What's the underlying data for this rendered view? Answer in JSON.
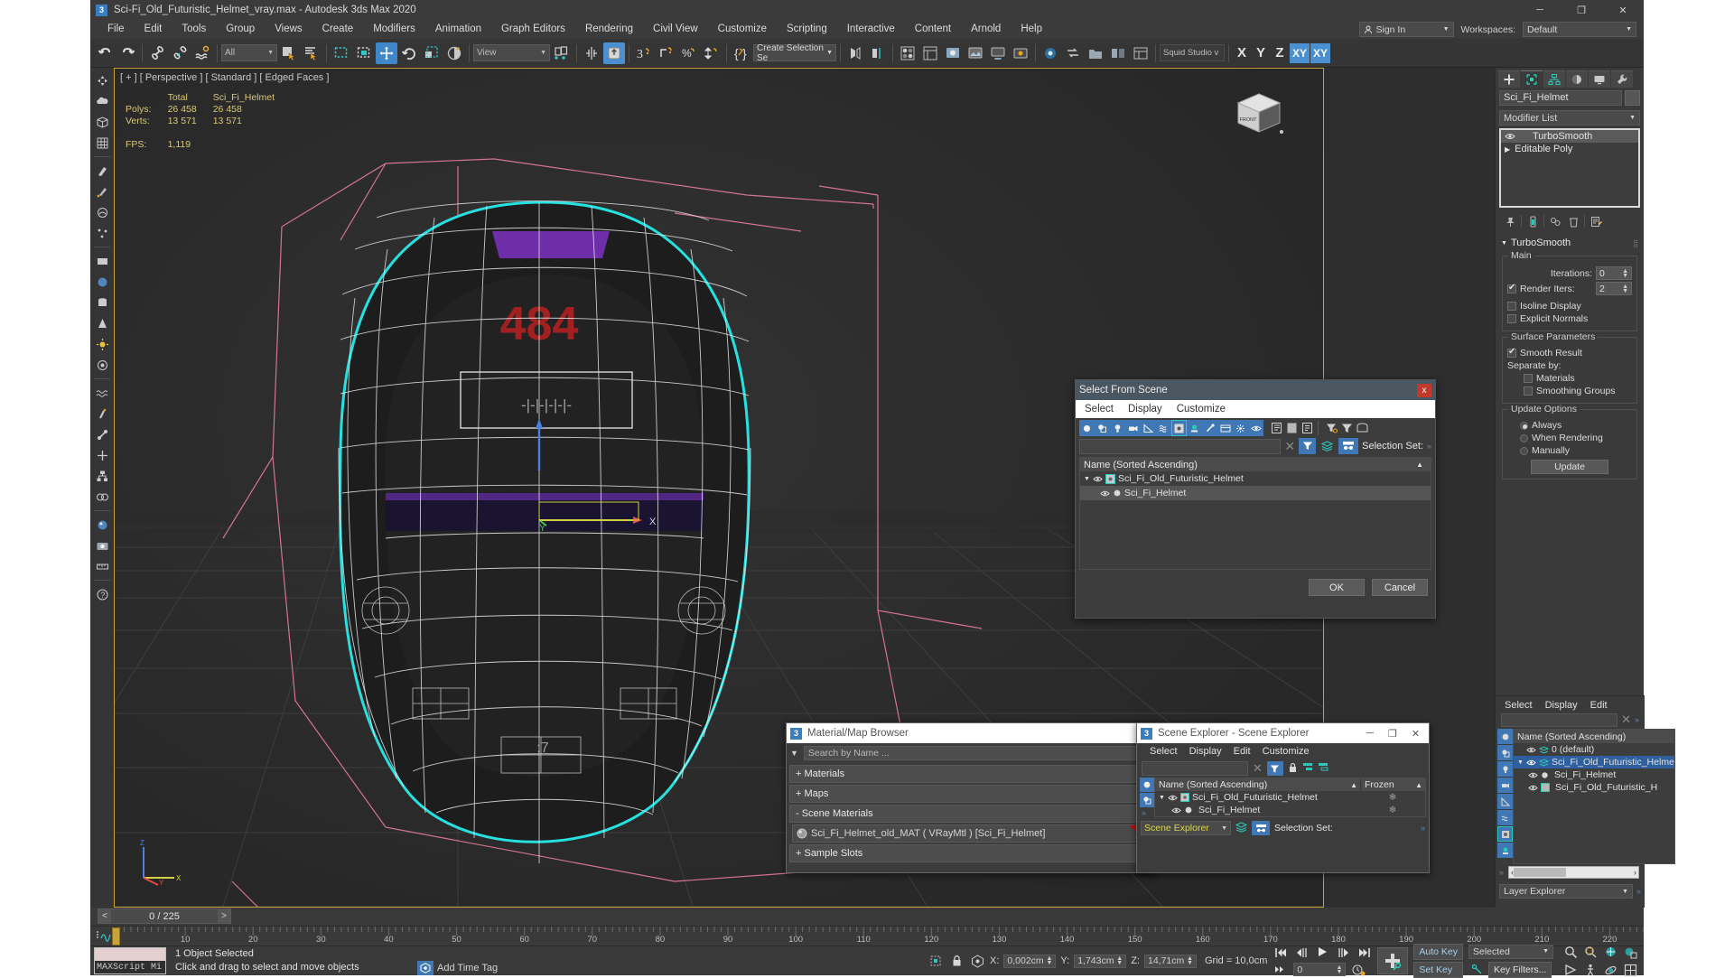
{
  "window": {
    "title": "Sci-Fi_Old_Futuristic_Helmet_vray.max - Autodesk 3ds Max 2020",
    "app_icon": "3",
    "minimize": "─",
    "maximize": "❐",
    "close": "✕"
  },
  "menubar": {
    "items": [
      "File",
      "Edit",
      "Tools",
      "Group",
      "Views",
      "Create",
      "Modifiers",
      "Animation",
      "Graph Editors",
      "Rendering",
      "Civil View",
      "Customize",
      "Scripting",
      "Interactive",
      "Content",
      "Arnold",
      "Help"
    ],
    "sign_in": "Sign In",
    "workspaces_label": "Workspaces:",
    "workspace_value": "Default"
  },
  "toolbar": {
    "selection_filter": "All",
    "reference_coord": "View",
    "named_selection_set": "Create Selection Se",
    "render_preset": "Squid Studio v",
    "axis_constraints": [
      "X",
      "Y",
      "Z",
      "XY",
      "XY"
    ],
    "active_axis": "XY"
  },
  "viewport": {
    "label": "[ + ] [ Perspective ] [ Standard ] [ Edged Faces ]",
    "stats": {
      "col_total": "Total",
      "col_object": "Sci_Fi_Helmet",
      "polys_label": "Polys:",
      "polys_total": "26 458",
      "polys_object": "26 458",
      "verts_label": "Verts:",
      "verts_total": "13 571",
      "verts_object": "13 571",
      "fps_label": "FPS:",
      "fps_value": "1,119"
    },
    "viewcube_face": "FRONT",
    "axis_x": "X",
    "axis_y": "Y",
    "axis_z": "Z"
  },
  "command_panel": {
    "object_name": "Sci_Fi_Helmet",
    "modifier_list": "Modifier List",
    "stack": [
      {
        "label": "TurboSmooth",
        "selected": true
      },
      {
        "label": "Editable Poly",
        "selected": false
      }
    ],
    "rollout_title": "TurboSmooth",
    "groups": {
      "main": {
        "title": "Main",
        "iterations_label": "Iterations:",
        "iterations_value": "0",
        "render_iters_label": "Render Iters:",
        "render_iters_value": "2",
        "render_iters_checked": true,
        "isoline_display": "Isoline Display",
        "explicit_normals": "Explicit Normals"
      },
      "surface": {
        "title": "Surface Parameters",
        "smooth_result": "Smooth Result",
        "smooth_result_checked": true,
        "separate_by": "Separate by:",
        "materials": "Materials",
        "smoothing_groups": "Smoothing Groups"
      },
      "update": {
        "title": "Update Options",
        "always": "Always",
        "when_rendering": "When Rendering",
        "manually": "Manually",
        "selected": "Always",
        "update_button": "Update"
      }
    }
  },
  "layer_explorer": {
    "menu": [
      "Select",
      "Display",
      "Edit"
    ],
    "column_header": "Name (Sorted Ascending)",
    "rows": [
      {
        "label": "0 (default)",
        "depth": 1,
        "state": "normal"
      },
      {
        "label": "Sci_Fi_Old_Futuristic_Helme",
        "depth": 1,
        "state": "selected"
      },
      {
        "label": "Sci_Fi_Helmet",
        "depth": 2,
        "state": "highlight"
      },
      {
        "label": "Sci_Fi_Old_Futuristic_H",
        "depth": 2,
        "state": "highlight"
      }
    ],
    "footer_combo": "Layer Explorer"
  },
  "select_from_scene": {
    "title": "Select From Scene",
    "close": "x",
    "menu": [
      "Select",
      "Display",
      "Customize"
    ],
    "search_value": "",
    "selection_set_label": "Selection Set:",
    "column_header": "Name (Sorted Ascending)",
    "rows": [
      {
        "label": "Sci_Fi_Old_Futuristic_Helmet",
        "depth": 0,
        "selected": false
      },
      {
        "label": "Sci_Fi_Helmet",
        "depth": 1,
        "selected": true
      }
    ],
    "ok": "OK",
    "cancel": "Cancel"
  },
  "material_browser": {
    "icon": "3",
    "title": "Material/Map Browser",
    "close": "✕",
    "search_placeholder": "Search by Name ...",
    "sections": [
      {
        "label": "+ Materials"
      },
      {
        "label": "+ Maps"
      },
      {
        "label": "- Scene Materials"
      },
      {
        "label": "+ Sample Slots"
      }
    ],
    "material_entry": "Sci_Fi_Helmet_old_MAT  ( VRayMtl )  [Sci_Fi_Helmet]"
  },
  "scene_explorer": {
    "icon": "3",
    "title": "Scene Explorer - Scene Explorer",
    "minimize": "─",
    "maximize": "❐",
    "close": "✕",
    "menu": [
      "Select",
      "Display",
      "Edit",
      "Customize"
    ],
    "column_name": "Name (Sorted Ascending)",
    "column_frozen": "Frozen",
    "rows": [
      {
        "label": "Sci_Fi_Old_Futuristic_Helmet",
        "depth": 0,
        "frozen": "❄"
      },
      {
        "label": "Sci_Fi_Helmet",
        "depth": 1,
        "frozen": "❄"
      }
    ],
    "footer_combo": "Scene Explorer",
    "selection_set_label": "Selection Set:"
  },
  "time_slider": {
    "value": "0 / 225",
    "prev": "<",
    "next": ">",
    "tick_labels": [
      "10",
      "20",
      "30",
      "40",
      "50",
      "60",
      "70",
      "80",
      "90",
      "100",
      "110",
      "120",
      "130",
      "140",
      "150",
      "160",
      "170",
      "180",
      "190",
      "200",
      "210",
      "220"
    ]
  },
  "status_bar": {
    "maxscript_label": "MAXScript Mi",
    "selection_status": "1 Object Selected",
    "prompt": "Click and drag to select and move objects",
    "x_label": "X:",
    "x_value": "0,002cm",
    "y_label": "Y:",
    "y_value": "1,743cm",
    "z_label": "Z:",
    "z_value": "14,71cm",
    "grid_label": "Grid = 10,0cm",
    "add_time_tag": "Add Time Tag",
    "auto_key": "Auto Key",
    "set_key": "Set Key",
    "key_filters": "Key Filters...",
    "selected_combo": "Selected",
    "frame_value": "0"
  },
  "colors": {
    "accent_blue": "#3f78b4",
    "panel_bg": "#3a3a3a",
    "viewport_bg": "#2b2b2b",
    "stats_yellow": "#d9c87a",
    "selection_cyan": "#27e0e0",
    "material_red": "#c01010",
    "title_dialog": "#4a5660"
  }
}
